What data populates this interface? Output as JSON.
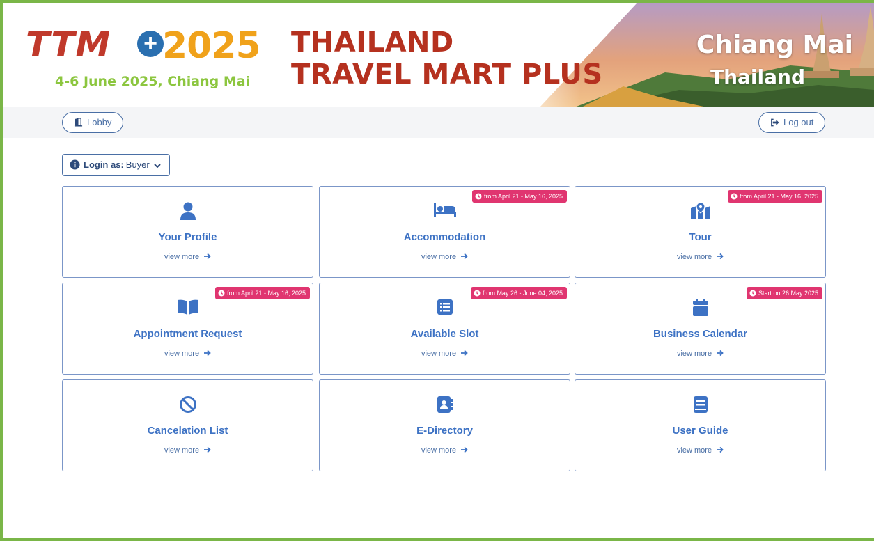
{
  "banner": {
    "logo_text": "TTM",
    "logo_plus": "+",
    "logo_year": "2025",
    "date_place": "4-6 June 2025, Chiang Mai",
    "title_line1": "THAILAND",
    "title_line2": "TRAVEL MART PLUS",
    "city": "Chiang Mai",
    "country": "Thailand"
  },
  "nav": {
    "lobby_label": "Lobby",
    "logout_label": "Log out"
  },
  "login": {
    "label": "Login as:",
    "value": "Buyer"
  },
  "cards": [
    {
      "title": "Your Profile",
      "more": "view more",
      "icon": "user-icon",
      "badge": ""
    },
    {
      "title": "Accommodation",
      "more": "view more",
      "icon": "bed-icon",
      "badge": "from April 21 - May 16, 2025"
    },
    {
      "title": "Tour",
      "more": "view more",
      "icon": "map-location-icon",
      "badge": "from April 21 - May 16, 2025"
    },
    {
      "title": "Appointment Request",
      "more": "view more",
      "icon": "open-book-icon",
      "badge": "from April 21 - May 16, 2025"
    },
    {
      "title": "Available Slot",
      "more": "view more",
      "icon": "list-icon",
      "badge": "from May 26 - June 04, 2025"
    },
    {
      "title": "Business Calendar",
      "more": "view more",
      "icon": "calendar-icon",
      "badge": "Start on 26 May 2025"
    },
    {
      "title": "Cancelation List",
      "more": "view more",
      "icon": "ban-icon",
      "badge": ""
    },
    {
      "title": "E-Directory",
      "more": "view more",
      "icon": "address-book-icon",
      "badge": ""
    },
    {
      "title": "User Guide",
      "more": "view more",
      "icon": "book-icon",
      "badge": ""
    }
  ],
  "colors": {
    "frame_green": "#7ab648",
    "title_red": "#b5311f",
    "card_blue": "#3d72c4",
    "badge_pink": "#e03570"
  }
}
